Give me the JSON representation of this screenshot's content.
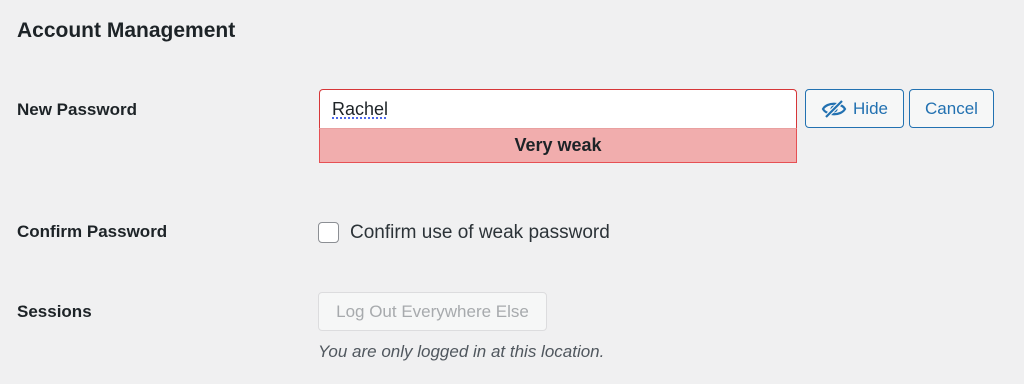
{
  "section": {
    "title": "Account Management"
  },
  "password": {
    "label": "New Password",
    "value": "Rachel",
    "strength": "Very weak",
    "hide_label": "Hide",
    "cancel_label": "Cancel",
    "hide_icon": "eye-slash-icon"
  },
  "confirm": {
    "label": "Confirm Password",
    "checkbox_label": "Confirm use of weak password",
    "checked": false
  },
  "sessions": {
    "label": "Sessions",
    "button_label": "Log Out Everywhere Else",
    "description": "You are only logged in at this location."
  },
  "colors": {
    "accent": "#2271b1",
    "weak_bg": "#f1adad",
    "weak_border": "#e65054",
    "page_bg": "#f0f0f1"
  }
}
